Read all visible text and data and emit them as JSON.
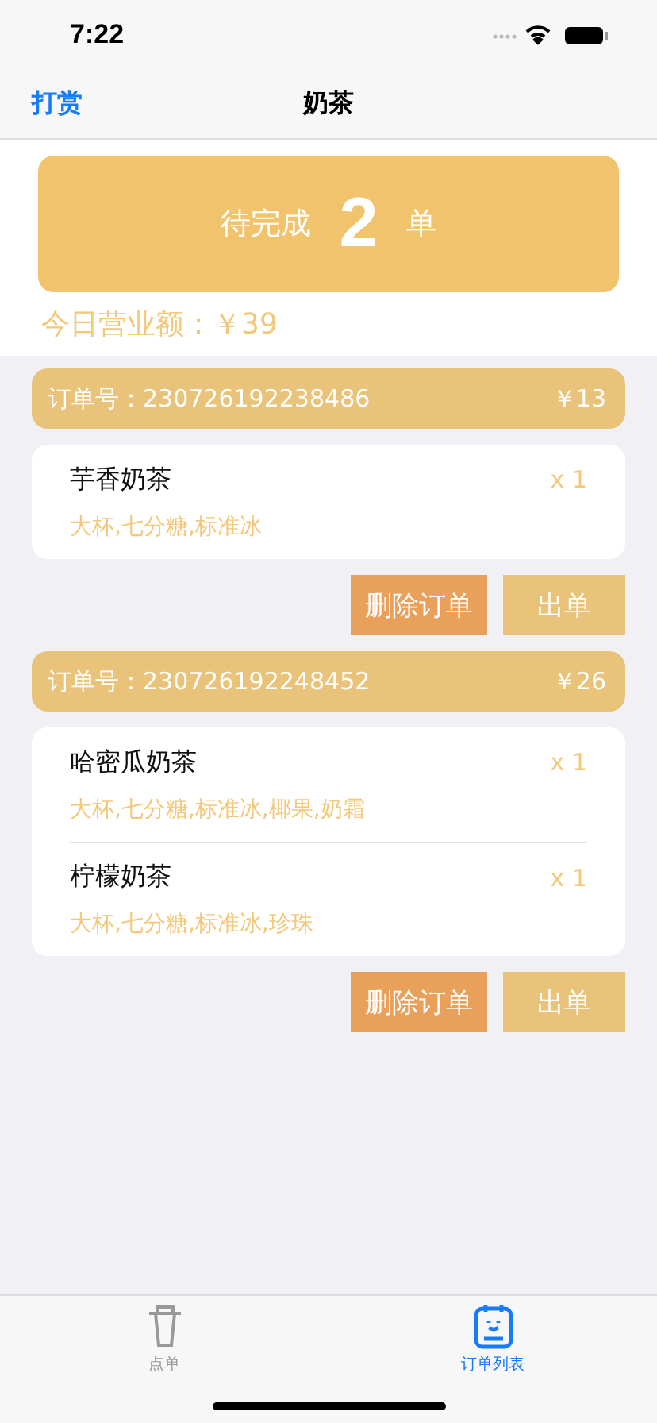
{
  "status_bar": {
    "time": "7:22"
  },
  "nav": {
    "left": "打赏",
    "title": "奶茶"
  },
  "summary": {
    "prefix": "待完成",
    "count": "2",
    "suffix": "单",
    "revenue": "今日营业额：￥39"
  },
  "orders": [
    {
      "number": "订单号：230726192238486",
      "total": "￥13",
      "items": [
        {
          "name": "芋香奶茶",
          "qty": "x 1",
          "options": "大杯,七分糖,标准冰"
        }
      ],
      "delete": "删除订单",
      "submit": "出单"
    },
    {
      "number": "订单号：230726192248452",
      "total": "￥26",
      "items": [
        {
          "name": "哈密瓜奶茶",
          "qty": "x 1",
          "options": "大杯,七分糖,标准冰,椰果,奶霜"
        },
        {
          "name": "柠檬奶茶",
          "qty": "x 1",
          "options": "大杯,七分糖,标准冰,珍珠"
        }
      ],
      "delete": "删除订单",
      "submit": "出单"
    }
  ],
  "tabs": [
    {
      "label": "点单",
      "kind": "cup",
      "selected": false
    },
    {
      "label": "订单列表",
      "kind": "list",
      "selected": true
    }
  ]
}
